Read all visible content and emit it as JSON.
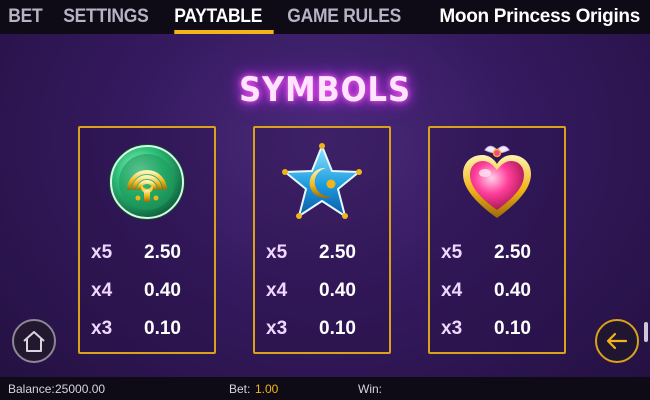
{
  "tabs": [
    {
      "label": "BET"
    },
    {
      "label": "SETTINGS"
    },
    {
      "label": "PAYTABLE",
      "active": true
    },
    {
      "label": "GAME RULES"
    }
  ],
  "game_title": "Moon Princess Origins",
  "section_title": "SYMBOLS",
  "symbols": [
    {
      "icon": "green-brooch-icon",
      "payouts": [
        {
          "mult": "x5",
          "pay": "2.50"
        },
        {
          "mult": "x4",
          "pay": "0.40"
        },
        {
          "mult": "x3",
          "pay": "0.10"
        }
      ]
    },
    {
      "icon": "blue-star-moon-icon",
      "payouts": [
        {
          "mult": "x5",
          "pay": "2.50"
        },
        {
          "mult": "x4",
          "pay": "0.40"
        },
        {
          "mult": "x3",
          "pay": "0.10"
        }
      ]
    },
    {
      "icon": "pink-heart-icon",
      "payouts": [
        {
          "mult": "x5",
          "pay": "2.50"
        },
        {
          "mult": "x4",
          "pay": "0.40"
        },
        {
          "mult": "x3",
          "pay": "0.10"
        }
      ]
    }
  ],
  "buttons": {
    "home_icon": "home-icon",
    "back_icon": "arrow-left-icon"
  },
  "footer": {
    "balance_label": "Balance:",
    "balance_value": "25000.00",
    "bet_label": "Bet:",
    "bet_value": "1.00",
    "win_label": "Win:"
  },
  "colors": {
    "accent": "#f2b418",
    "background": "#34195e",
    "bar": "#0e0a16"
  }
}
